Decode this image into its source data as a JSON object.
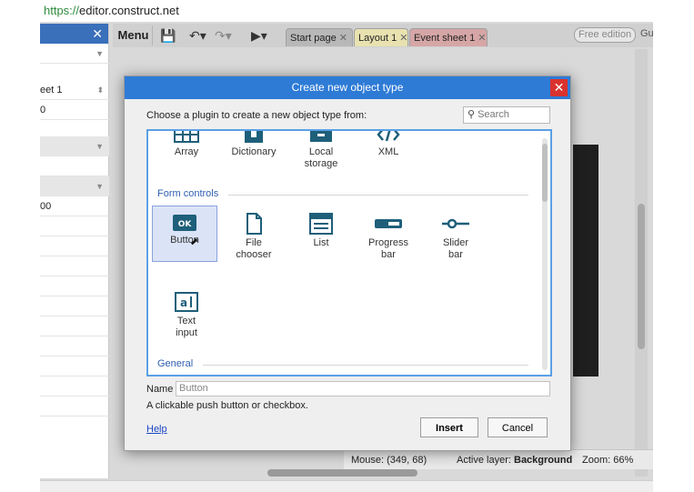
{
  "browser": {
    "url_scheme": "https://",
    "url_host": "editor.construct.net"
  },
  "left_panel": {
    "close": "✕",
    "rows": [
      {
        "text": ""
      },
      {
        "text": "eet 1"
      },
      {
        "text": "0"
      },
      {
        "text": ""
      },
      {
        "text": "00"
      }
    ]
  },
  "toolbar": {
    "menu": "Menu",
    "tabs": [
      {
        "label": "Start page"
      },
      {
        "label": "Layout 1"
      },
      {
        "label": "Event sheet 1"
      }
    ],
    "tab_close": "✕",
    "free_edition": "Free edition",
    "guest": "Guest"
  },
  "statusbar": {
    "mouse": "Mouse: (349, 68)",
    "active_layer_label": "Active layer:",
    "active_layer_value": "Background",
    "zoom": "Zoom: 66%"
  },
  "dialog": {
    "title": "Create new object type",
    "close": "✕",
    "prompt": "Choose a plugin to create a new object type from:",
    "search_placeholder": "Search",
    "data_storage_items": [
      {
        "label": "Array",
        "icon": "array-icon"
      },
      {
        "label": "Dictionary",
        "icon": "dictionary-icon"
      },
      {
        "label": "Local\nstorage",
        "icon": "local-storage-icon"
      },
      {
        "label": "XML",
        "icon": "xml-icon"
      }
    ],
    "section_form": "Form controls",
    "form_items": [
      {
        "label": "Button",
        "icon": "button-icon"
      },
      {
        "label": "File\nchooser",
        "icon": "file-chooser-icon"
      },
      {
        "label": "List",
        "icon": "list-icon"
      },
      {
        "label": "Progress\nbar",
        "icon": "progress-bar-icon"
      },
      {
        "label": "Slider\nbar",
        "icon": "slider-bar-icon"
      },
      {
        "label": "Text\ninput",
        "icon": "text-input-icon"
      }
    ],
    "section_general": "General",
    "name_label": "Name",
    "name_value": "Button",
    "description": "A clickable push button or checkbox.",
    "help": "Help",
    "insert": "Insert",
    "cancel": "Cancel"
  },
  "colors": {
    "accent": "#2e7bd6",
    "icon_teal": "#1f5f7a",
    "close_red": "#d9322f"
  }
}
